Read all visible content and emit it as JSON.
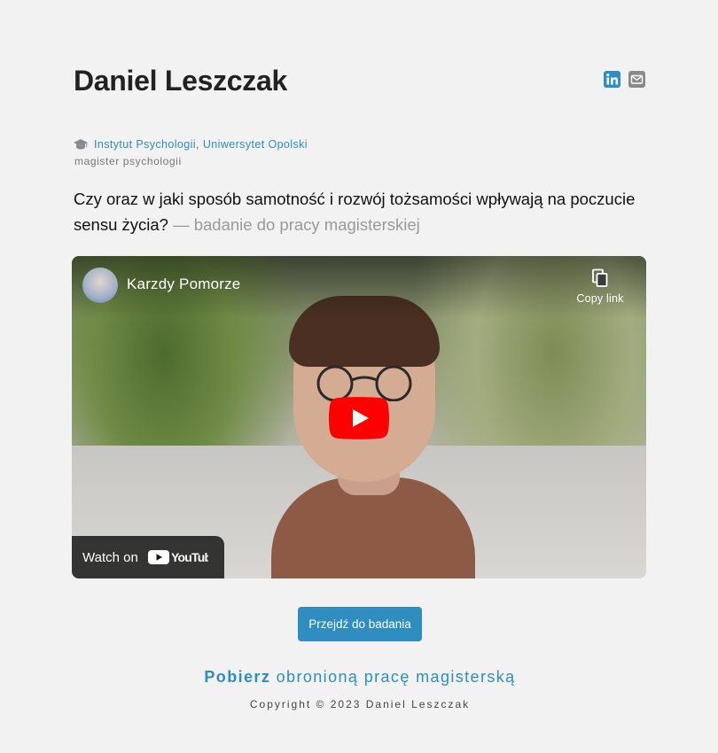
{
  "header": {
    "name": "Daniel Leszczak",
    "institute": "Instytut Psychologii",
    "separator": ",",
    "university": "Uniwersytet Opolski",
    "degree": "magister psychologii",
    "social": [
      {
        "icon": "linkedin-icon",
        "color": "#2f8dbf"
      },
      {
        "icon": "mail-icon",
        "color": "#8a8a8a"
      }
    ]
  },
  "lead": {
    "question": "Czy oraz w jaki sposób samotność i rozwój tożsamości wpływają na poczucie sensu życia?",
    "note": "— badanie do pracy magisterskiej"
  },
  "video": {
    "channel": "Karzdy Pomorze",
    "copy_label": "Copy link",
    "watch_label": "Watch on",
    "platform": "YouTube"
  },
  "cta": {
    "label": "Przejdź do badania"
  },
  "download": {
    "bold": "Pobierz",
    "rest": "obronioną pracę magisterską"
  },
  "footer": {
    "copyright": "Copyright © 2023 Daniel Leszczak"
  },
  "colors": {
    "accent": "#2f8dbf",
    "background": "#f2f2f2",
    "youtube_red": "#ff0000"
  }
}
